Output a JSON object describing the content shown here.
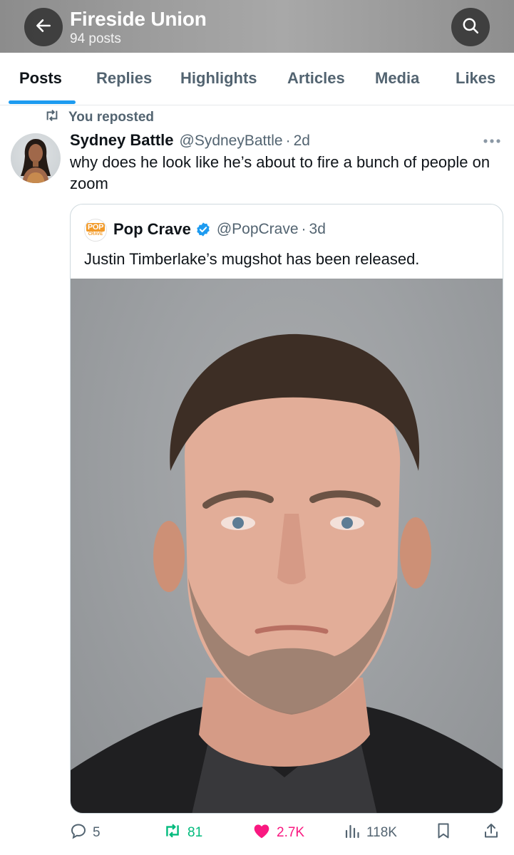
{
  "header": {
    "title": "Fireside Union",
    "post_count": "94 posts",
    "back_icon": "arrow-left-icon",
    "search_icon": "search-icon"
  },
  "tabs": [
    {
      "label": "Posts",
      "active": true
    },
    {
      "label": "Replies",
      "active": false
    },
    {
      "label": "Highlights",
      "active": false
    },
    {
      "label": "Articles",
      "active": false
    },
    {
      "label": "Media",
      "active": false
    },
    {
      "label": "Likes",
      "active": false
    }
  ],
  "repost": {
    "text": "You reposted",
    "icon": "repost-icon"
  },
  "tweet": {
    "author_name": "Sydney Battle",
    "author_handle": "@SydneyBattle",
    "separator": "·",
    "time": "2d",
    "text": "why does he look like he’s about to fire a bunch of people on zoom",
    "avatar_icon": "avatar"
  },
  "quote": {
    "logo_text_top": "POP",
    "logo_text_bottom": "CRAVE",
    "name": "Pop Crave",
    "handle": "@PopCrave",
    "separator": "·",
    "time": "3d",
    "text": "Justin Timberlake’s mugshot has been released.",
    "verified_icon": "verified-badge-icon"
  },
  "actions": {
    "replies": "5",
    "reposts": "81",
    "likes": "2.7K",
    "views": "118K"
  },
  "colors": {
    "accent": "#1d9bf0",
    "repost_green": "#00ba7c",
    "like_pink": "#f91880",
    "muted": "#536471"
  }
}
